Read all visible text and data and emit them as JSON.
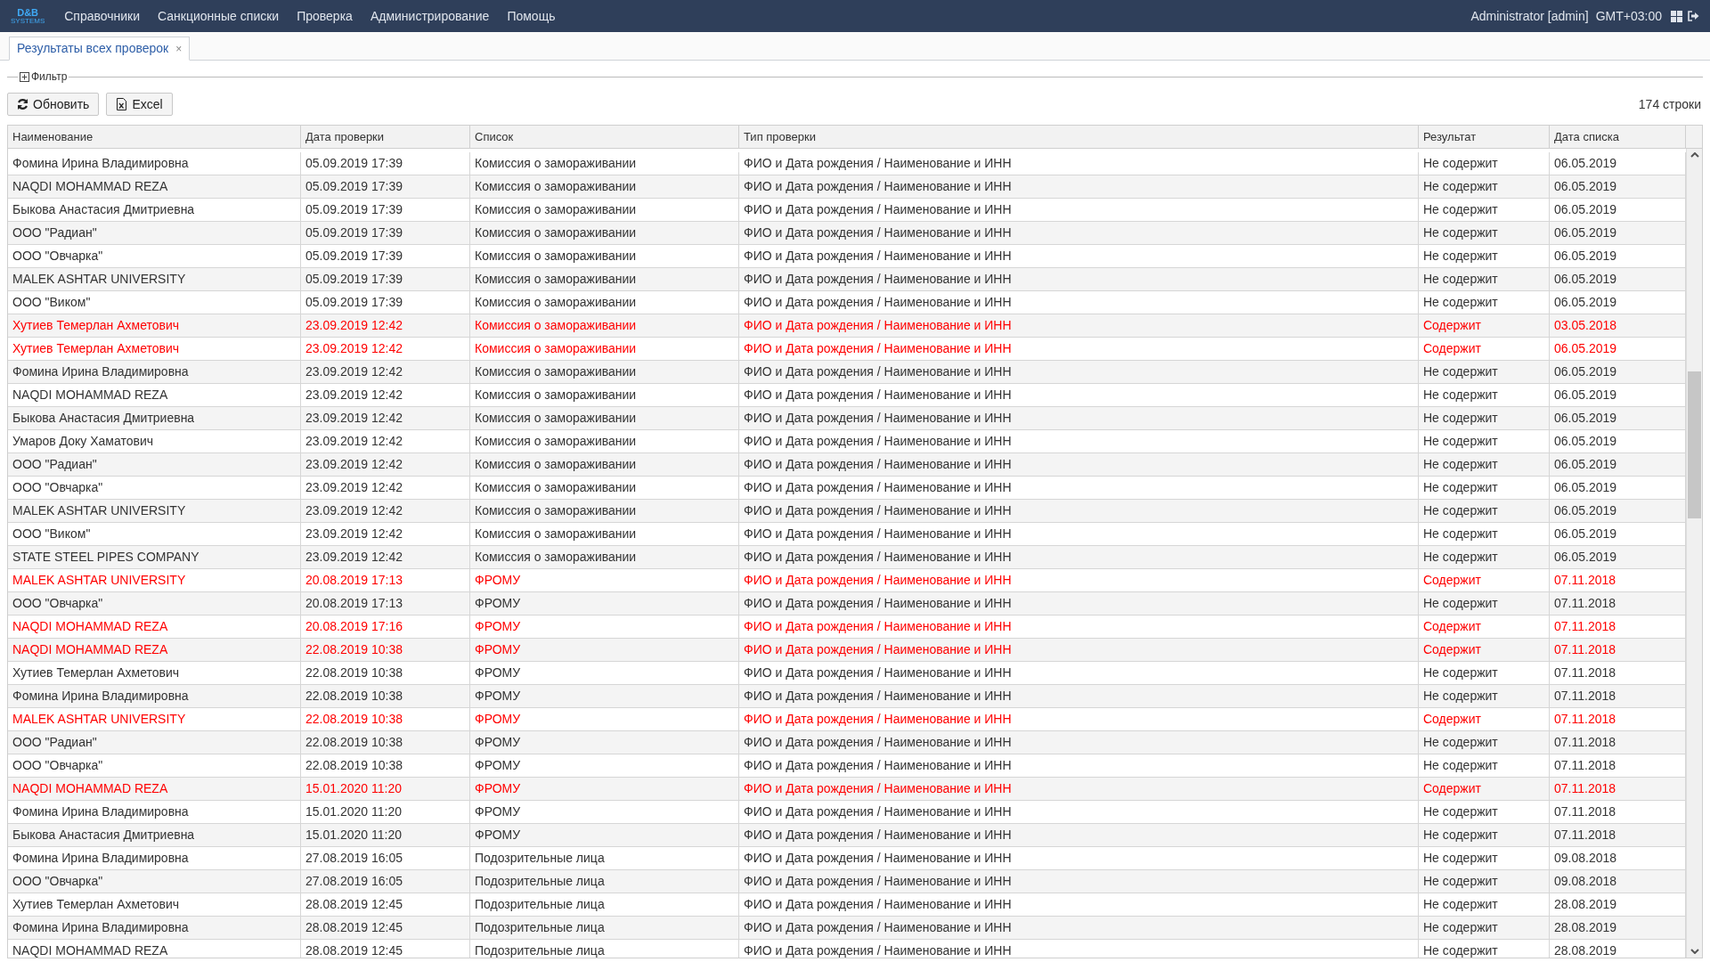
{
  "navbar": {
    "logo": "D&B",
    "logo_sub": "SYSTEMS",
    "menu": [
      "Справочники",
      "Санкционные списки",
      "Проверка",
      "Администрирование",
      "Помощь"
    ],
    "user": "Administrator [admin]",
    "timezone": "GMT+03:00"
  },
  "tabs": [
    {
      "label": "Результаты всех проверок",
      "selected": true,
      "close": "×"
    }
  ],
  "filter": {
    "label": "Фильтр",
    "expanded": false
  },
  "toolbar": {
    "buttons": [
      {
        "label": "Обновить",
        "kind": "refresh"
      },
      {
        "label": "Excel",
        "kind": "excel"
      }
    ],
    "row_count": "174 строки"
  },
  "table": {
    "columns": [
      "Наименование",
      "Дата проверки",
      "Список",
      "Тип проверки",
      "Результат",
      "Дата списка"
    ],
    "rows": [
      {
        "cells": [
          "Фомина Ирина Владимировна",
          "05.09.2019 17:39",
          "Комиссия о замораживании",
          "ФИО и Дата рождения / Наименование и ИНН",
          "Не содержит",
          "06.05.2019"
        ],
        "match": false
      },
      {
        "cells": [
          "NAQDI MOHAMMAD REZA",
          "05.09.2019 17:39",
          "Комиссия о замораживании",
          "ФИО и Дата рождения / Наименование и ИНН",
          "Не содержит",
          "06.05.2019"
        ],
        "match": false
      },
      {
        "cells": [
          "Быкова Анастасия Дмитриевна",
          "05.09.2019 17:39",
          "Комиссия о замораживании",
          "ФИО и Дата рождения / Наименование и ИНН",
          "Не содержит",
          "06.05.2019"
        ],
        "match": false
      },
      {
        "cells": [
          "ООО \"Радиан\"",
          "05.09.2019 17:39",
          "Комиссия о замораживании",
          "ФИО и Дата рождения / Наименование и ИНН",
          "Не содержит",
          "06.05.2019"
        ],
        "match": false
      },
      {
        "cells": [
          "ООО \"Овчарка\"",
          "05.09.2019 17:39",
          "Комиссия о замораживании",
          "ФИО и Дата рождения / Наименование и ИНН",
          "Не содержит",
          "06.05.2019"
        ],
        "match": false
      },
      {
        "cells": [
          "MALEK ASHTAR UNIVERSITY",
          "05.09.2019 17:39",
          "Комиссия о замораживании",
          "ФИО и Дата рождения / Наименование и ИНН",
          "Не содержит",
          "06.05.2019"
        ],
        "match": false
      },
      {
        "cells": [
          "ООО \"Виком\"",
          "05.09.2019 17:39",
          "Комиссия о замораживании",
          "ФИО и Дата рождения / Наименование и ИНН",
          "Не содержит",
          "06.05.2019"
        ],
        "match": false
      },
      {
        "cells": [
          "Хутиев Темерлан Ахметович",
          "23.09.2019 12:42",
          "Комиссия о замораживании",
          "ФИО и Дата рождения / Наименование и ИНН",
          "Содержит",
          "03.05.2018"
        ],
        "match": true
      },
      {
        "cells": [
          "Хутиев Темерлан Ахметович",
          "23.09.2019 12:42",
          "Комиссия о замораживании",
          "ФИО и Дата рождения / Наименование и ИНН",
          "Содержит",
          "06.05.2019"
        ],
        "match": true
      },
      {
        "cells": [
          "Фомина Ирина Владимировна",
          "23.09.2019 12:42",
          "Комиссия о замораживании",
          "ФИО и Дата рождения / Наименование и ИНН",
          "Не содержит",
          "06.05.2019"
        ],
        "match": false
      },
      {
        "cells": [
          "NAQDI MOHAMMAD REZA",
          "23.09.2019 12:42",
          "Комиссия о замораживании",
          "ФИО и Дата рождения / Наименование и ИНН",
          "Не содержит",
          "06.05.2019"
        ],
        "match": false
      },
      {
        "cells": [
          "Быкова Анастасия Дмитриевна",
          "23.09.2019 12:42",
          "Комиссия о замораживании",
          "ФИО и Дата рождения / Наименование и ИНН",
          "Не содержит",
          "06.05.2019"
        ],
        "match": false
      },
      {
        "cells": [
          "Умаров Доку Хаматович",
          "23.09.2019 12:42",
          "Комиссия о замораживании",
          "ФИО и Дата рождения / Наименование и ИНН",
          "Не содержит",
          "06.05.2019"
        ],
        "match": false
      },
      {
        "cells": [
          "ООО \"Радиан\"",
          "23.09.2019 12:42",
          "Комиссия о замораживании",
          "ФИО и Дата рождения / Наименование и ИНН",
          "Не содержит",
          "06.05.2019"
        ],
        "match": false
      },
      {
        "cells": [
          "ООО \"Овчарка\"",
          "23.09.2019 12:42",
          "Комиссия о замораживании",
          "ФИО и Дата рождения / Наименование и ИНН",
          "Не содержит",
          "06.05.2019"
        ],
        "match": false
      },
      {
        "cells": [
          "MALEK ASHTAR UNIVERSITY",
          "23.09.2019 12:42",
          "Комиссия о замораживании",
          "ФИО и Дата рождения / Наименование и ИНН",
          "Не содержит",
          "06.05.2019"
        ],
        "match": false
      },
      {
        "cells": [
          "ООО \"Виком\"",
          "23.09.2019 12:42",
          "Комиссия о замораживании",
          "ФИО и Дата рождения / Наименование и ИНН",
          "Не содержит",
          "06.05.2019"
        ],
        "match": false
      },
      {
        "cells": [
          "STATE STEEL PIPES COMPANY",
          "23.09.2019 12:42",
          "Комиссия о замораживании",
          "ФИО и Дата рождения / Наименование и ИНН",
          "Не содержит",
          "06.05.2019"
        ],
        "match": false
      },
      {
        "cells": [
          "MALEK ASHTAR UNIVERSITY",
          "20.08.2019 17:13",
          "ФРОМУ",
          "ФИО и Дата рождения / Наименование и ИНН",
          "Содержит",
          "07.11.2018"
        ],
        "match": true
      },
      {
        "cells": [
          "ООО \"Овчарка\"",
          "20.08.2019 17:13",
          "ФРОМУ",
          "ФИО и Дата рождения / Наименование и ИНН",
          "Не содержит",
          "07.11.2018"
        ],
        "match": false
      },
      {
        "cells": [
          "NAQDI MOHAMMAD REZA",
          "20.08.2019 17:16",
          "ФРОМУ",
          "ФИО и Дата рождения / Наименование и ИНН",
          "Содержит",
          "07.11.2018"
        ],
        "match": true
      },
      {
        "cells": [
          "NAQDI MOHAMMAD REZA",
          "22.08.2019 10:38",
          "ФРОМУ",
          "ФИО и Дата рождения / Наименование и ИНН",
          "Содержит",
          "07.11.2018"
        ],
        "match": true
      },
      {
        "cells": [
          "Хутиев Темерлан Ахметович",
          "22.08.2019 10:38",
          "ФРОМУ",
          "ФИО и Дата рождения / Наименование и ИНН",
          "Не содержит",
          "07.11.2018"
        ],
        "match": false
      },
      {
        "cells": [
          "Фомина Ирина Владимировна",
          "22.08.2019 10:38",
          "ФРОМУ",
          "ФИО и Дата рождения / Наименование и ИНН",
          "Не содержит",
          "07.11.2018"
        ],
        "match": false
      },
      {
        "cells": [
          "MALEK ASHTAR UNIVERSITY",
          "22.08.2019 10:38",
          "ФРОМУ",
          "ФИО и Дата рождения / Наименование и ИНН",
          "Содержит",
          "07.11.2018"
        ],
        "match": true
      },
      {
        "cells": [
          "ООО \"Радиан\"",
          "22.08.2019 10:38",
          "ФРОМУ",
          "ФИО и Дата рождения / Наименование и ИНН",
          "Не содержит",
          "07.11.2018"
        ],
        "match": false
      },
      {
        "cells": [
          "ООО \"Овчарка\"",
          "22.08.2019 10:38",
          "ФРОМУ",
          "ФИО и Дата рождения / Наименование и ИНН",
          "Не содержит",
          "07.11.2018"
        ],
        "match": false
      },
      {
        "cells": [
          "NAQDI MOHAMMAD REZA",
          "15.01.2020 11:20",
          "ФРОМУ",
          "ФИО и Дата рождения / Наименование и ИНН",
          "Содержит",
          "07.11.2018"
        ],
        "match": true
      },
      {
        "cells": [
          "Фомина Ирина Владимировна",
          "15.01.2020 11:20",
          "ФРОМУ",
          "ФИО и Дата рождения / Наименование и ИНН",
          "Не содержит",
          "07.11.2018"
        ],
        "match": false
      },
      {
        "cells": [
          "Быкова Анастасия Дмитриевна",
          "15.01.2020 11:20",
          "ФРОМУ",
          "ФИО и Дата рождения / Наименование и ИНН",
          "Не содержит",
          "07.11.2018"
        ],
        "match": false
      },
      {
        "cells": [
          "Фомина Ирина Владимировна",
          "27.08.2019 16:05",
          "Подозрительные лица",
          "ФИО и Дата рождения / Наименование и ИНН",
          "Не содержит",
          "09.08.2018"
        ],
        "match": false
      },
      {
        "cells": [
          "ООО \"Овчарка\"",
          "27.08.2019 16:05",
          "Подозрительные лица",
          "ФИО и Дата рождения / Наименование и ИНН",
          "Не содержит",
          "09.08.2018"
        ],
        "match": false
      },
      {
        "cells": [
          "Хутиев Темерлан Ахметович",
          "28.08.2019 12:45",
          "Подозрительные лица",
          "ФИО и Дата рождения / Наименование и ИНН",
          "Не содержит",
          "28.08.2019"
        ],
        "match": false
      },
      {
        "cells": [
          "Фомина Ирина Владимировна",
          "28.08.2019 12:45",
          "Подозрительные лица",
          "ФИО и Дата рождения / Наименование и ИНН",
          "Не содержит",
          "28.08.2019"
        ],
        "match": false
      },
      {
        "cells": [
          "NAQDI MOHAMMAD REZA",
          "28.08.2019 12:45",
          "Подозрительные лица",
          "ФИО и Дата рождения / Наименование и ИНН",
          "Не содержит",
          "28.08.2019"
        ],
        "match": false
      }
    ]
  }
}
